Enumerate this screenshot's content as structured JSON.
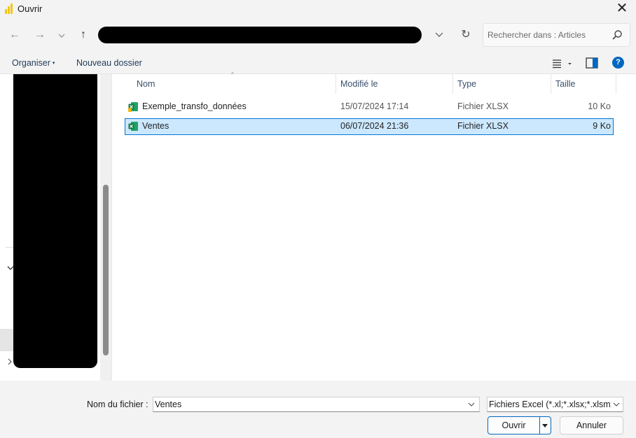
{
  "window": {
    "title": "Ouvrir",
    "close": "✕"
  },
  "nav": {
    "back": "←",
    "forward": "→",
    "history": "⌄",
    "up": "↑",
    "refresh": "↻",
    "search_placeholder": "Rechercher dans : Articles"
  },
  "toolbar": {
    "organize": "Organiser",
    "organize_caret": "▾",
    "new_folder": "Nouveau dossier",
    "help": "?"
  },
  "columns": {
    "name": "Nom",
    "modified": "Modifié le",
    "type": "Type",
    "size": "Taille",
    "sort_indicator": "^"
  },
  "files": [
    {
      "name": "Exemple_transfo_données",
      "modified": "15/07/2024 17:14",
      "type": "Fichier XLSX",
      "size": "10 Ko",
      "selected": false
    },
    {
      "name": "Ventes",
      "modified": "06/07/2024 21:36",
      "type": "Fichier XLSX",
      "size": "9 Ko",
      "selected": true
    }
  ],
  "footer": {
    "filename_label": "Nom du fichier :",
    "filename_value": "Ventes",
    "filter": "Fichiers Excel (*.xl;*.xlsx;*.xlsm;*.xlsb",
    "open": "Ouvrir",
    "cancel": "Annuler"
  },
  "colors": {
    "accent": "#0067c0",
    "selection": "#cce8ff",
    "selection_border": "#0078d7",
    "excel_green": "#1d6f42"
  }
}
